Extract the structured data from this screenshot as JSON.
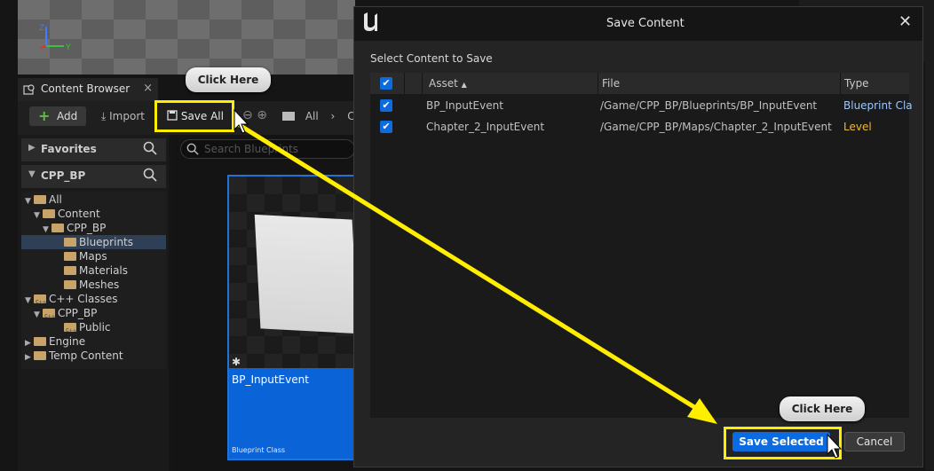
{
  "viewport": {
    "axis_z": "Z",
    "axis_y": "Y"
  },
  "content_browser": {
    "tab_label": "Content Browser",
    "add_label": "Add",
    "import_label": "Import",
    "save_all_label": "Save All",
    "breadcrumb_all": "All",
    "breadcrumb_more": "C",
    "favorites_label": "Favorites",
    "project_label": "CPP_BP",
    "search_placeholder": "Search Blueprints",
    "tree": [
      {
        "label": "All"
      },
      {
        "label": "Content"
      },
      {
        "label": "CPP_BP"
      },
      {
        "label": "Blueprints",
        "selected": true
      },
      {
        "label": "Maps"
      },
      {
        "label": "Materials"
      },
      {
        "label": "Meshes"
      },
      {
        "label": "C++ Classes"
      },
      {
        "label": "CPP_BP"
      },
      {
        "label": "Public"
      },
      {
        "label": "Engine"
      },
      {
        "label": "Temp Content"
      }
    ],
    "asset": {
      "name": "BP_InputEvent",
      "class": "Blueprint Class"
    }
  },
  "dialog": {
    "title": "Save Content",
    "select_label": "Select Content to Save",
    "columns": {
      "asset": "Asset",
      "file": "File",
      "type": "Type"
    },
    "rows": [
      {
        "asset": "BP_InputEvent",
        "file": "/Game/CPP_BP/Blueprints/BP_InputEvent",
        "type": "Blueprint Cla"
      },
      {
        "asset": "Chapter_2_InputEvent",
        "file": "/Game/CPP_BP/Maps/Chapter_2_InputEvent",
        "type": "Level"
      }
    ],
    "save_selected_label": "Save Selected",
    "cancel_label": "Cancel"
  },
  "callouts": {
    "top": "Click Here",
    "bottom": "Click Here"
  },
  "colors": {
    "highlight": "#ffee00",
    "accent_blue": "#0c6be0",
    "level_type": "#f0b838"
  }
}
